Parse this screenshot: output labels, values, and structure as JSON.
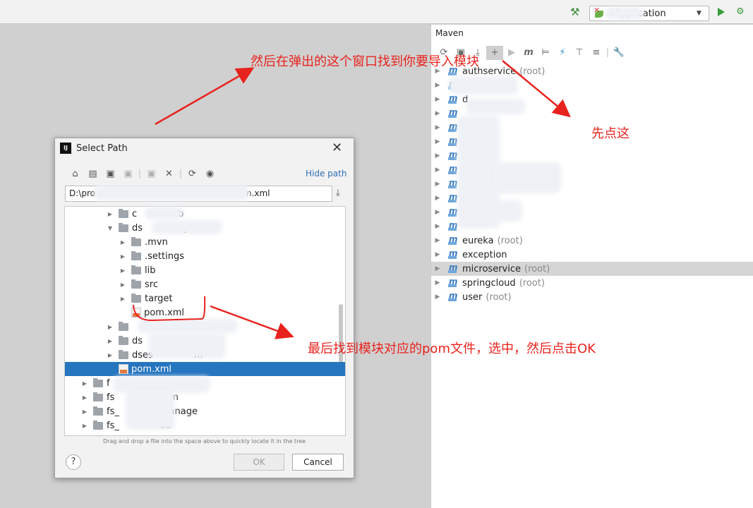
{
  "toolbar": {
    "run_config": "oApplication",
    "build_icon": "hammer-icon",
    "run_icon": "play-icon",
    "debug_icon": "bug-icon"
  },
  "maven": {
    "title": "Maven",
    "projects": [
      {
        "name": "authservice",
        "root": "(root)"
      },
      {
        "name": "",
        "root": ""
      },
      {
        "name": "d",
        "root": ""
      },
      {
        "name": "",
        "root": ""
      },
      {
        "name": "",
        "root": ""
      },
      {
        "name": "",
        "root": ""
      },
      {
        "name": "",
        "root": ""
      },
      {
        "name": "",
        "root": ""
      },
      {
        "name": "",
        "root": ""
      },
      {
        "name": "",
        "root": ""
      },
      {
        "name": "",
        "root": ""
      },
      {
        "name": "",
        "root": ""
      },
      {
        "name": "eureka",
        "root": "(root)"
      },
      {
        "name": "exception",
        "root": ""
      },
      {
        "name": "microservice",
        "root": "(root)"
      },
      {
        "name": "springcloud",
        "root": "(root)"
      },
      {
        "name": "user",
        "root": "(root)"
      }
    ],
    "selected_index": 14
  },
  "dialog": {
    "title": "Select Path",
    "hide_path": "Hide path",
    "path_value": "D:\\pro",
    "path_suffix": "n.xml",
    "tree": [
      {
        "name": "c",
        "suffix": "b",
        "type": "folder",
        "depth": 3,
        "expanded": false
      },
      {
        "name": "ds",
        "suffix": "y",
        "type": "folder",
        "depth": 3,
        "expanded": true
      },
      {
        "name": ".mvn",
        "suffix": "",
        "type": "folder",
        "depth": 4,
        "expanded": false
      },
      {
        "name": ".settings",
        "suffix": "",
        "type": "folder",
        "depth": 4,
        "expanded": false
      },
      {
        "name": "lib",
        "suffix": "",
        "type": "folder",
        "depth": 4,
        "expanded": false
      },
      {
        "name": "src",
        "suffix": "",
        "type": "folder",
        "depth": 4,
        "expanded": false
      },
      {
        "name": "target",
        "suffix": "",
        "type": "folder",
        "depth": 4,
        "expanded": false
      },
      {
        "name": "pom.xml",
        "suffix": "",
        "type": "xml",
        "depth": 4,
        "expanded": null
      },
      {
        "name": "",
        "suffix": "",
        "type": "folder",
        "depth": 3,
        "expanded": false
      },
      {
        "name": "ds",
        "suffix": "y",
        "type": "folder",
        "depth": 3,
        "expanded": false
      },
      {
        "name": "dses",
        "suffix": "m",
        "type": "folder",
        "depth": 3,
        "expanded": false
      },
      {
        "name": "pom.xml",
        "suffix": "",
        "type": "xml",
        "depth": 3,
        "expanded": null
      },
      {
        "name": "f",
        "suffix": "",
        "type": "folder",
        "depth": 1,
        "expanded": false
      },
      {
        "name": "fs",
        "suffix": "stem",
        "type": "folder",
        "depth": 1,
        "expanded": false
      },
      {
        "name": "fs_",
        "suffix": "manage",
        "type": "folder",
        "depth": 1,
        "expanded": false
      },
      {
        "name": "fs_",
        "suffix": "eb",
        "type": "folder",
        "depth": 1,
        "expanded": false
      }
    ],
    "selected_index": 11,
    "hint": "Drag and drop a file into the space above to quickly locate it in the tree",
    "ok": "OK",
    "cancel": "Cancel",
    "help": "?"
  },
  "annotations": {
    "top": "然后在弹出的这个窗口找到你要导入模块",
    "right": "先点这",
    "bottom": "最后找到模块对应的pom文件，选中，然后点击OK",
    "color": "#e8231d"
  }
}
